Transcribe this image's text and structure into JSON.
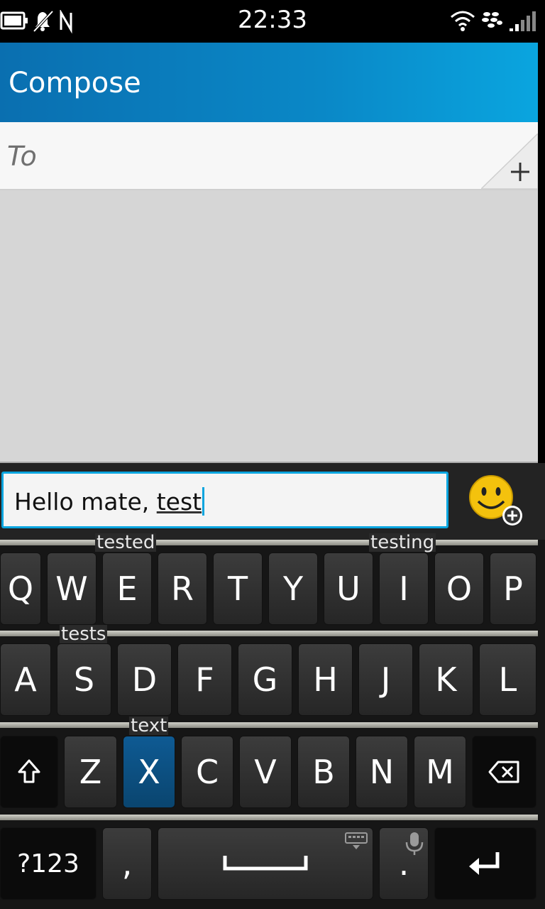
{
  "status_bar": {
    "time": "22:33",
    "icons": [
      "battery-icon",
      "notifications-muted-icon",
      "nfc-icon",
      "wifi-icon",
      "blackberry-icon",
      "signal-icon"
    ]
  },
  "header": {
    "title": "Compose"
  },
  "recipient": {
    "placeholder": "To",
    "add_icon": "plus-icon"
  },
  "compose": {
    "text_before": "Hello mate, ",
    "current_word": "test",
    "emoji_icon": "emoji-add-icon"
  },
  "keyboard": {
    "suggestions": {
      "tested": "tested",
      "testing": "testing",
      "tests": "tests",
      "text": "text"
    },
    "row1": [
      "Q",
      "W",
      "E",
      "R",
      "T",
      "Y",
      "U",
      "I",
      "O",
      "P"
    ],
    "row2": [
      "A",
      "S",
      "D",
      "F",
      "G",
      "H",
      "J",
      "K",
      "L"
    ],
    "row3": [
      "Z",
      "X",
      "C",
      "V",
      "B",
      "N",
      "M"
    ],
    "symbols_label": "?123",
    "comma": ",",
    "period": ".",
    "active_key": "X"
  },
  "colors": {
    "accent": "#0aa5df",
    "header_start": "#0a6fb0",
    "header_end": "#0aa5df",
    "active_key": "#0e5a93"
  }
}
